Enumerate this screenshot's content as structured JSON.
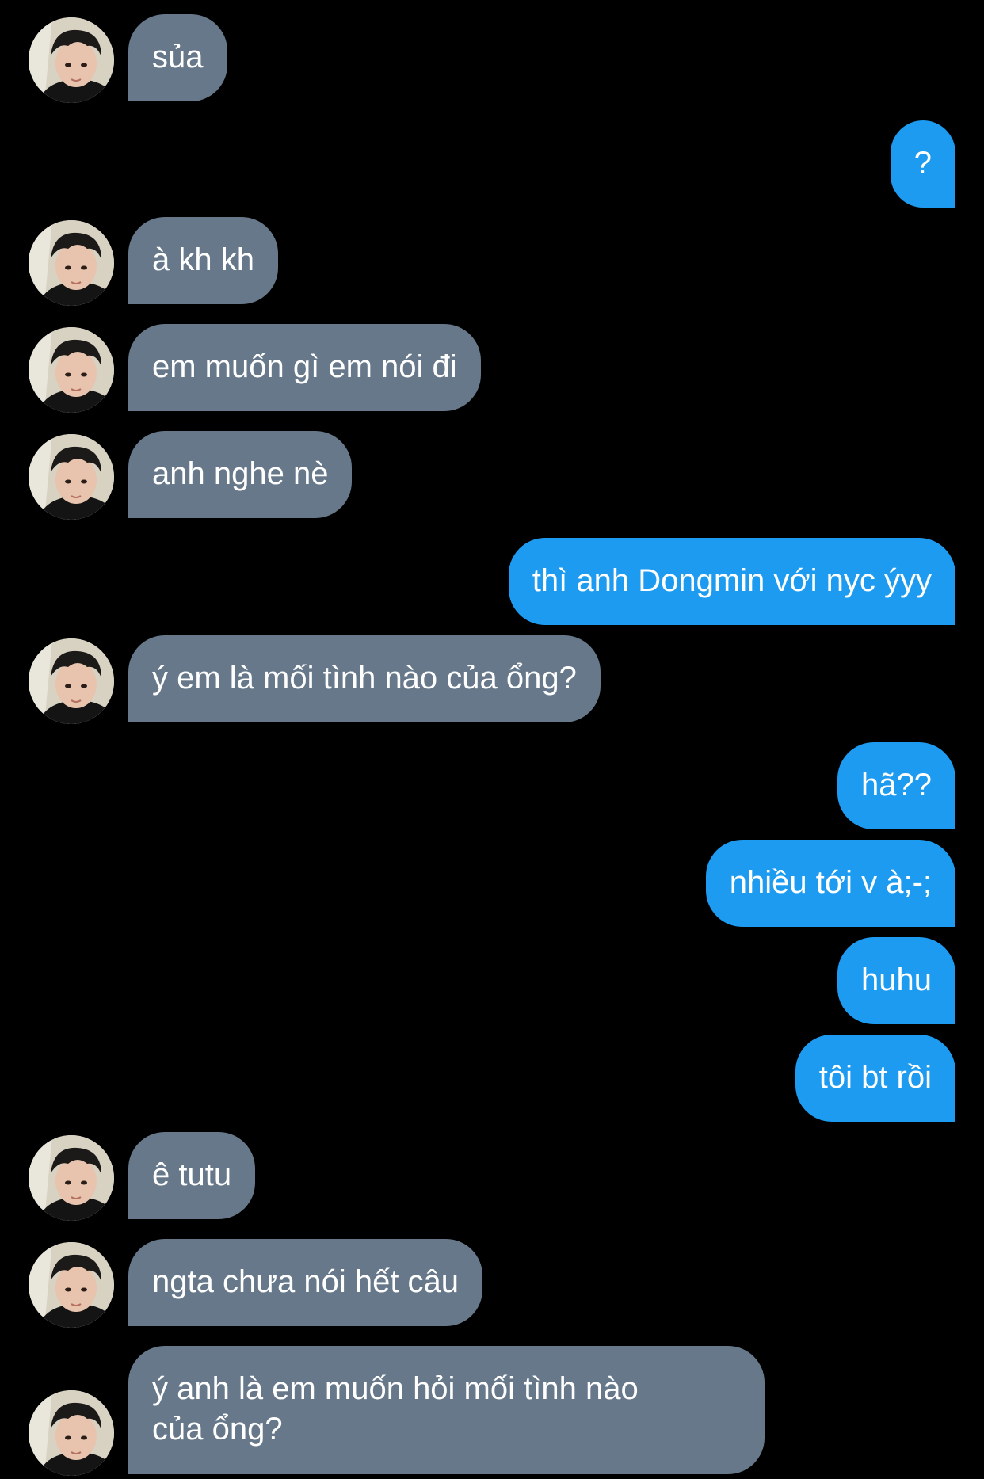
{
  "conversation": {
    "messages": [
      {
        "direction": "incoming",
        "text": "sủa"
      },
      {
        "direction": "outgoing",
        "text": "?"
      },
      {
        "direction": "incoming",
        "text": "à kh kh"
      },
      {
        "direction": "incoming",
        "text": "em muốn gì em nói đi"
      },
      {
        "direction": "incoming",
        "text": "anh nghe nè"
      },
      {
        "direction": "outgoing",
        "text": "thì anh Dongmin với nyc ýyy"
      },
      {
        "direction": "incoming",
        "text": "ý em là mối tình nào của ổng?"
      },
      {
        "direction": "outgoing",
        "text": "hã??"
      },
      {
        "direction": "outgoing",
        "text": "nhiều tới v à;-;"
      },
      {
        "direction": "outgoing",
        "text": "huhu"
      },
      {
        "direction": "outgoing",
        "text": "tôi bt rồi"
      },
      {
        "direction": "incoming",
        "text": "ê tutu"
      },
      {
        "direction": "incoming",
        "text": "ngta chưa nói hết câu"
      },
      {
        "direction": "incoming",
        "text_line1": "ý anh là em muốn hỏi mối tình nào",
        "text_line2": "của ổng?"
      }
    ]
  },
  "colors": {
    "background": "#000000",
    "incoming_bubble": "#66788a",
    "outgoing_bubble": "#1d9bf0",
    "text": "#ffffff"
  },
  "icons": {
    "avatar": "contact-avatar-photo"
  }
}
